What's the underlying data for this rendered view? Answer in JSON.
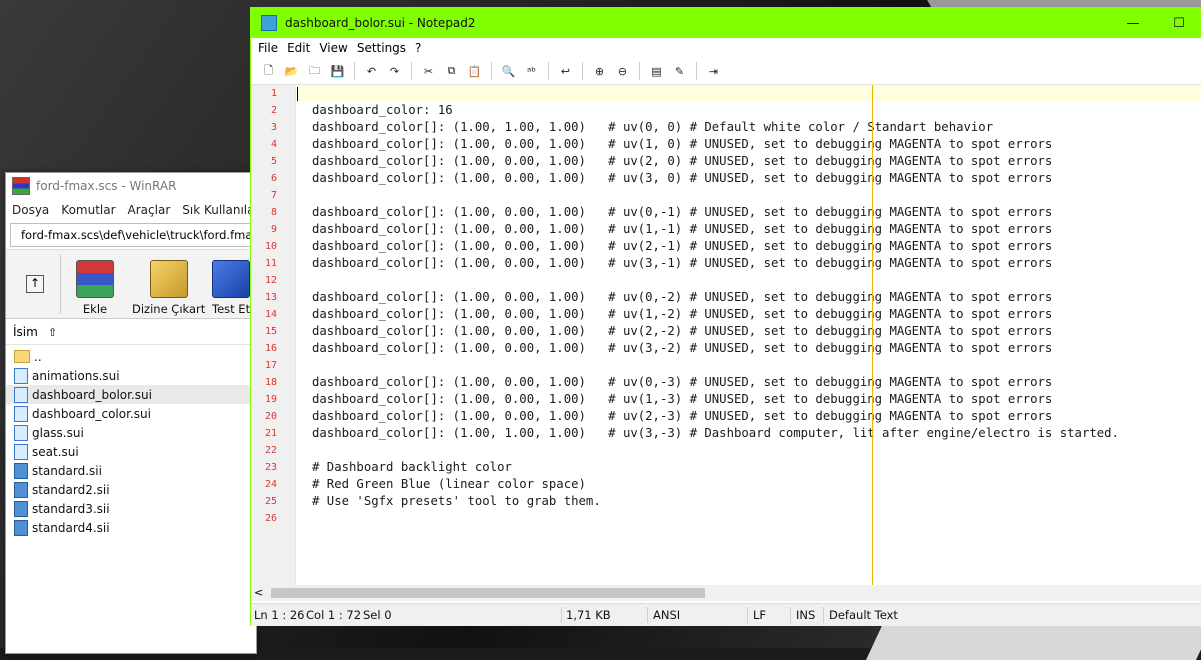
{
  "winrar": {
    "title": "ford-fmax.scs - WinRAR",
    "menu": [
      "Dosya",
      "Komutlar",
      "Araçlar",
      "Sık Kullanılanla"
    ],
    "path": "ford-fmax.scs\\def\\vehicle\\truck\\ford.fmax\\interior -",
    "tools": [
      {
        "label": "Ekle",
        "icon": "add-archive-icon"
      },
      {
        "label": "Dizine Çıkart",
        "icon": "extract-icon"
      },
      {
        "label": "Test Et",
        "icon": "test-icon"
      }
    ],
    "up_icon": "folder-up-icon",
    "column_header": "İsim",
    "files": [
      {
        "name": "..",
        "type": "folder"
      },
      {
        "name": "animations.sui",
        "type": "sui"
      },
      {
        "name": "dashboard_bolor.sui",
        "type": "sui",
        "selected": true
      },
      {
        "name": "dashboard_color.sui",
        "type": "sui"
      },
      {
        "name": "glass.sui",
        "type": "sui"
      },
      {
        "name": "seat.sui",
        "type": "sui"
      },
      {
        "name": "standard.sii",
        "type": "sii"
      },
      {
        "name": "standard2.sii",
        "type": "sii"
      },
      {
        "name": "standard3.sii",
        "type": "sii"
      },
      {
        "name": "standard4.sii",
        "type": "sii"
      }
    ]
  },
  "notepad": {
    "title": "dashboard_bolor.sui - Notepad2",
    "title_bar_color": "#80ff00",
    "window_buttons": [
      "—",
      "☐"
    ],
    "menu": [
      "File",
      "Edit",
      "View",
      "Settings",
      "?"
    ],
    "lines": [
      "",
      "dashboard_color: 16",
      "dashboard_color[]: (1.00, 1.00, 1.00)   # uv(0, 0) # Default white color / Standart behavior",
      "dashboard_color[]: (1.00, 0.00, 1.00)   # uv(1, 0) # UNUSED, set to debugging MAGENTA to spot errors",
      "dashboard_color[]: (1.00, 0.00, 1.00)   # uv(2, 0) # UNUSED, set to debugging MAGENTA to spot errors",
      "dashboard_color[]: (1.00, 0.00, 1.00)   # uv(3, 0) # UNUSED, set to debugging MAGENTA to spot errors",
      "",
      "dashboard_color[]: (1.00, 0.00, 1.00)   # uv(0,-1) # UNUSED, set to debugging MAGENTA to spot errors",
      "dashboard_color[]: (1.00, 0.00, 1.00)   # uv(1,-1) # UNUSED, set to debugging MAGENTA to spot errors",
      "dashboard_color[]: (1.00, 0.00, 1.00)   # uv(2,-1) # UNUSED, set to debugging MAGENTA to spot errors",
      "dashboard_color[]: (1.00, 0.00, 1.00)   # uv(3,-1) # UNUSED, set to debugging MAGENTA to spot errors",
      "",
      "dashboard_color[]: (1.00, 0.00, 1.00)   # uv(0,-2) # UNUSED, set to debugging MAGENTA to spot errors",
      "dashboard_color[]: (1.00, 0.00, 1.00)   # uv(1,-2) # UNUSED, set to debugging MAGENTA to spot errors",
      "dashboard_color[]: (1.00, 0.00, 1.00)   # uv(2,-2) # UNUSED, set to debugging MAGENTA to spot errors",
      "dashboard_color[]: (1.00, 0.00, 1.00)   # uv(3,-2) # UNUSED, set to debugging MAGENTA to spot errors",
      "",
      "dashboard_color[]: (1.00, 0.00, 1.00)   # uv(0,-3) # UNUSED, set to debugging MAGENTA to spot errors",
      "dashboard_color[]: (1.00, 0.00, 1.00)   # uv(1,-3) # UNUSED, set to debugging MAGENTA to spot errors",
      "dashboard_color[]: (1.00, 0.00, 1.00)   # uv(2,-3) # UNUSED, set to debugging MAGENTA to spot errors",
      "dashboard_color[]: (1.00, 1.00, 1.00)   # uv(3,-3) # Dashboard computer, lit after engine/electro is started.",
      "",
      "# Dashboard backlight color",
      "# Red Green Blue (linear color space)",
      "# Use 'Sgfx presets' tool to grab them.",
      ""
    ],
    "status": {
      "position": "Ln 1 : 26",
      "column": "Col 1 : 72",
      "selection": "Sel 0",
      "size": "1,71 KB",
      "encoding": "ANSI",
      "eol": "LF",
      "mode": "INS",
      "scheme": "Default Text"
    }
  }
}
